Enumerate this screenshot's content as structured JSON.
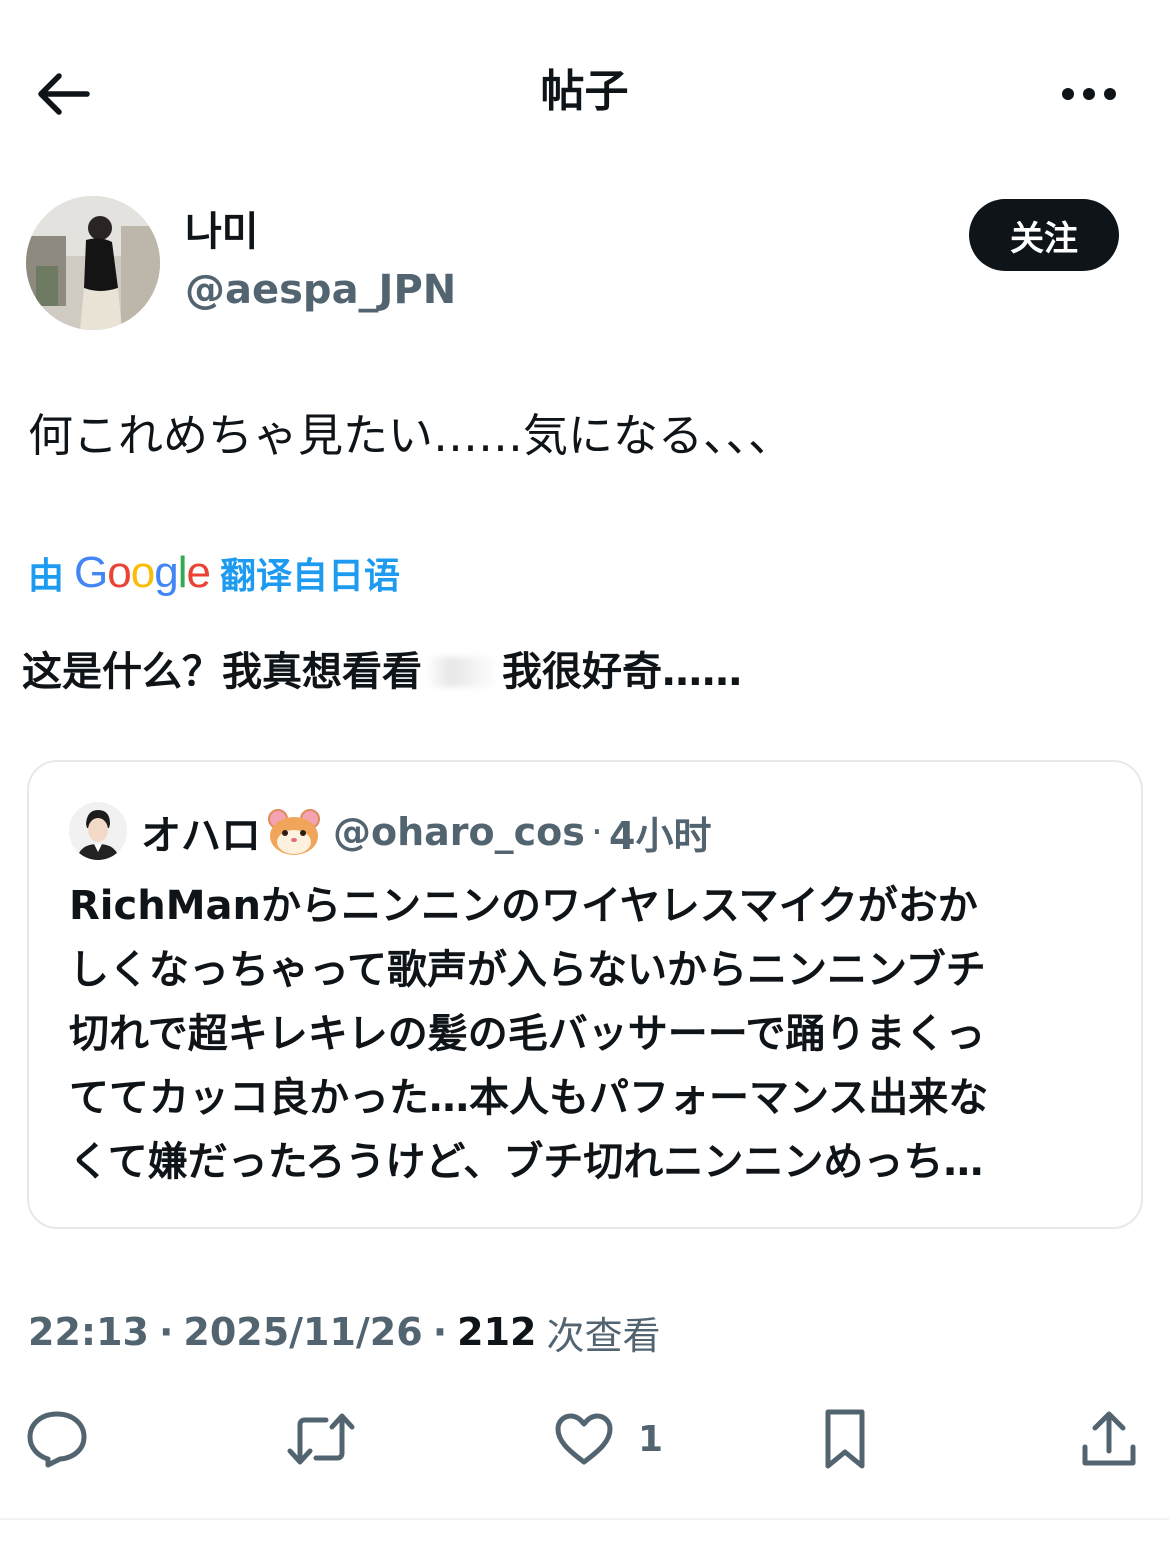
{
  "header": {
    "title": "帖子",
    "back_icon": "arrow-left-icon",
    "more_icon": "more-horizontal-icon"
  },
  "author": {
    "name": "나미",
    "handle": "@aespa_JPN",
    "follow_label": "关注"
  },
  "post": {
    "text": "何これめちゃ見たい……気になる、、、",
    "translation": {
      "prefix": "由",
      "provider": "Google",
      "suffix": "翻译自日语",
      "text_part1": "这是什么？我真想看看",
      "text_part2": "我很好奇……"
    }
  },
  "quote": {
    "name": "オハロ",
    "emoji": "🐹",
    "handle": "@oharo_cos",
    "separator": "·",
    "time": "4小时",
    "lines": [
      "RichManからニンニンのワイヤレスマイクがおか",
      "しくなっちゃって歌声が入らないからニンニンブチ",
      "切れで超キレキレの髪の毛バッサーーで踊りまくっ",
      "ててカッコ良かった…本人もパフォーマンス出来な",
      "くて嫌だったろうけど、ブチ切れニンニンめっち…"
    ]
  },
  "meta": {
    "time": "22:13",
    "date": "2025/11/26",
    "separator": "·",
    "views_count": "212",
    "views_label": "次查看"
  },
  "actions": {
    "like_count": "1"
  },
  "colors": {
    "text": "#0f1419",
    "secondary": "#536471",
    "link": "#1d9bf0",
    "follow_bg": "#0f1419",
    "border": "#e6e9ec"
  }
}
